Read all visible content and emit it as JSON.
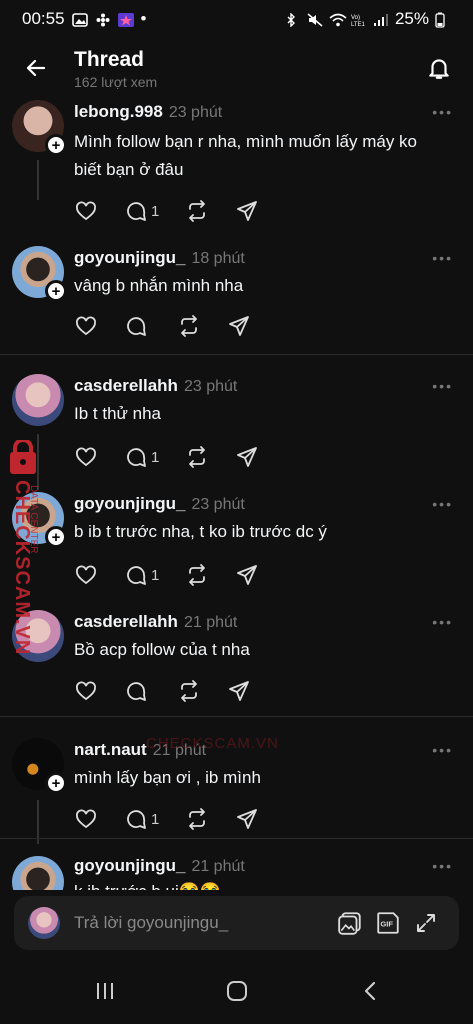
{
  "status_bar": {
    "time": "00:55",
    "dot": "•",
    "battery": "25%",
    "icons": [
      "gallery-icon",
      "flower-icon",
      "app-icon",
      "bluetooth-icon",
      "mute-icon",
      "wifi-icon",
      "volte-icon",
      "signal-icon",
      "battery-icon"
    ]
  },
  "header": {
    "title": "Thread",
    "subtitle": "162 lượt xem"
  },
  "replies": [
    {
      "username": "lebong.998",
      "time": "23 phút",
      "text": "Mình follow bạn r nha, mình muốn lấy máy ko biết bạn ở đâu",
      "comment_count": "1"
    },
    {
      "username": "goyounjingu_",
      "time": "18 phút",
      "text": "vâng b nhắn mình nha",
      "comment_count": ""
    },
    {
      "username": "casderellahh",
      "time": "23 phút",
      "text": "Ib t thử nha",
      "comment_count": "1"
    },
    {
      "username": "goyounjingu_",
      "time": "23 phút",
      "text": "b ib t trước nha, t ko ib trước dc ý",
      "comment_count": "1"
    },
    {
      "username": "casderellahh",
      "time": "21 phút",
      "text": "Bồ acp follow của t nha",
      "comment_count": ""
    },
    {
      "username": "nart.naut",
      "time": "21 phút",
      "text": "mình lấy bạn ơi , ib mình",
      "comment_count": "1"
    },
    {
      "username": "goyounjingu_",
      "time": "21 phút",
      "text": "k ib trước b ui😭😭",
      "comment_count": ""
    }
  ],
  "more_label": "•••",
  "watermark": {
    "main": "CHECKSCAM.VN",
    "sub": "DATA CENTER",
    "center": "CHECKSCAM.VN"
  },
  "reply_bar": {
    "placeholder": "Trả lời goyounjingu_"
  },
  "colors": {
    "background": "#101010",
    "text": "#f3f5f7",
    "muted": "#777777",
    "watermark": "#c0262e"
  }
}
